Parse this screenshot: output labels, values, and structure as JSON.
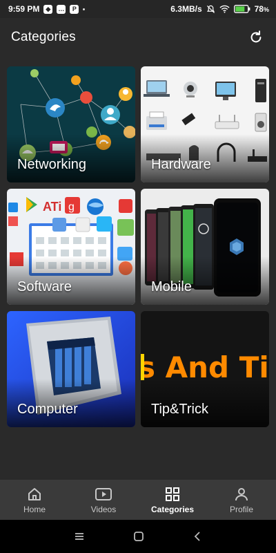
{
  "status_bar": {
    "time": "9:59 PM",
    "speed": "6.3MB/s",
    "battery": "78"
  },
  "header": {
    "title": "Categories",
    "refresh_icon": "refresh-icon"
  },
  "categories": [
    {
      "label": "Networking",
      "image": "network-graph-image"
    },
    {
      "label": "Hardware",
      "image": "computer-hardware-image"
    },
    {
      "label": "Software",
      "image": "software-app-icons-image"
    },
    {
      "label": "Mobile",
      "image": "smartphones-image"
    },
    {
      "label": "Computer",
      "image": "cpu-chip-image"
    },
    {
      "label": "Tip&Trick",
      "image": "tips-and-tricks-banner",
      "banner_text": "s And Ti"
    }
  ],
  "bottom_nav": [
    {
      "label": "Home",
      "icon": "home-icon"
    },
    {
      "label": "Videos",
      "icon": "video-play-icon"
    },
    {
      "label": "Categories",
      "icon": "grid-icon",
      "active": true
    },
    {
      "label": "Profile",
      "icon": "person-icon"
    }
  ],
  "colors": {
    "background": "#2a2a2a",
    "bottom_nav": "#3a3a3a",
    "active": "#ffffff",
    "inactive": "#c8c8c8",
    "banner_orange": "#ff8a00"
  }
}
